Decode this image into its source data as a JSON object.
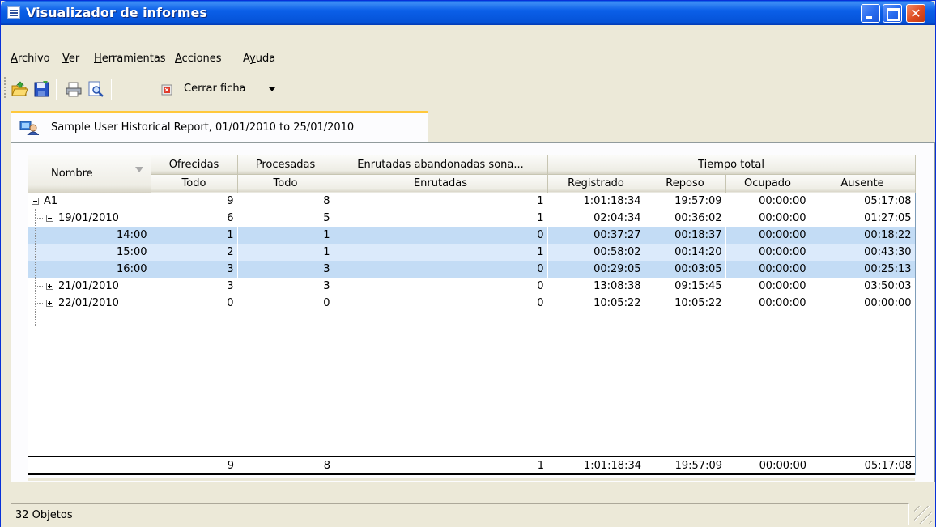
{
  "window": {
    "title": "Visualizador de informes"
  },
  "menu": [
    {
      "label": "Archivo",
      "ul": "A"
    },
    {
      "label": "Ver",
      "ul": "V"
    },
    {
      "label": "Herramientas",
      "ul": "H"
    },
    {
      "label": "Acciones",
      "ul": "A"
    },
    {
      "label": "Ayuda",
      "ul": "y"
    }
  ],
  "toolbar": {
    "close_card_label": "Cerrar ficha"
  },
  "tab": {
    "label": "Sample User Historical Report, 01/01/2010 to 25/01/2010"
  },
  "grid": {
    "header_top": {
      "nombre": "Nombre",
      "ofrecidas": "Ofrecidas",
      "procesadas": "Procesadas",
      "enrutadas": "Enrutadas abandonadas sona...",
      "tiempo_total": "Tiempo total"
    },
    "header_sub": {
      "ofrecidas": "Todo",
      "procesadas": "Todo",
      "enrutadas": "Enrutadas",
      "registrado": "Registrado",
      "reposo": "Reposo",
      "ocupado": "Ocupado",
      "ausente": "Ausente"
    },
    "rows": [
      {
        "name": "A1",
        "ofrecidas": "9",
        "procesadas": "8",
        "enrutadas": "1",
        "registrado": "1:01:18:34",
        "reposo": "19:57:09",
        "ocupado": "00:00:00",
        "ausente": "05:17:08"
      },
      {
        "name": "19/01/2010",
        "ofrecidas": "6",
        "procesadas": "5",
        "enrutadas": "1",
        "registrado": "02:04:34",
        "reposo": "00:36:02",
        "ocupado": "00:00:00",
        "ausente": "01:27:05"
      },
      {
        "name": "14:00",
        "ofrecidas": "1",
        "procesadas": "1",
        "enrutadas": "0",
        "registrado": "00:37:27",
        "reposo": "00:18:37",
        "ocupado": "00:00:00",
        "ausente": "00:18:22"
      },
      {
        "name": "15:00",
        "ofrecidas": "2",
        "procesadas": "1",
        "enrutadas": "1",
        "registrado": "00:58:02",
        "reposo": "00:14:20",
        "ocupado": "00:00:00",
        "ausente": "00:43:30"
      },
      {
        "name": "16:00",
        "ofrecidas": "3",
        "procesadas": "3",
        "enrutadas": "0",
        "registrado": "00:29:05",
        "reposo": "00:03:05",
        "ocupado": "00:00:00",
        "ausente": "00:25:13"
      },
      {
        "name": "21/01/2010",
        "ofrecidas": "3",
        "procesadas": "3",
        "enrutadas": "0",
        "registrado": "13:08:38",
        "reposo": "09:15:45",
        "ocupado": "00:00:00",
        "ausente": "03:50:03"
      },
      {
        "name": "22/01/2010",
        "ofrecidas": "0",
        "procesadas": "0",
        "enrutadas": "0",
        "registrado": "10:05:22",
        "reposo": "10:05:22",
        "ocupado": "00:00:00",
        "ausente": "00:00:00"
      }
    ],
    "totals": {
      "ofrecidas": "9",
      "procesadas": "8",
      "enrutadas": "1",
      "registrado": "1:01:18:34",
      "reposo": "19:57:09",
      "ocupado": "00:00:00",
      "ausente": "05:17:08"
    }
  },
  "status": {
    "text": "32 Objetos"
  },
  "colors": {
    "selected_row": "#c3dcf5",
    "title_bar": "#0553d8"
  }
}
